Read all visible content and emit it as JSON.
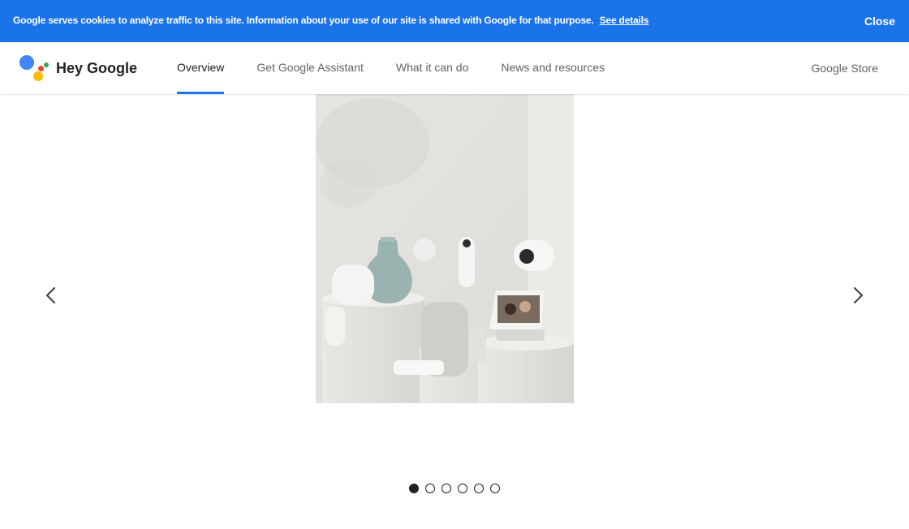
{
  "cookie": {
    "message": "Google serves cookies to analyze traffic to this site. Information about your use of our site is shared with Google for that purpose.",
    "link_label": "See details",
    "close_label": "Close"
  },
  "brand": {
    "name": "Hey Google",
    "colors": {
      "blue": "#4285f4",
      "red": "#ea4335",
      "yellow": "#fbbc04",
      "green": "#34a853"
    }
  },
  "nav": {
    "tabs": [
      {
        "label": "Overview",
        "active": true
      },
      {
        "label": "Get Google Assistant",
        "active": false
      },
      {
        "label": "What it can do",
        "active": false
      },
      {
        "label": "News and resources",
        "active": false
      }
    ],
    "store_label": "Google Store",
    "accent_color": "#1a73e8"
  },
  "carousel": {
    "prev_icon": "chevron-left-icon",
    "next_icon": "chevron-right-icon",
    "slide_count": 6,
    "active_index": 0
  }
}
